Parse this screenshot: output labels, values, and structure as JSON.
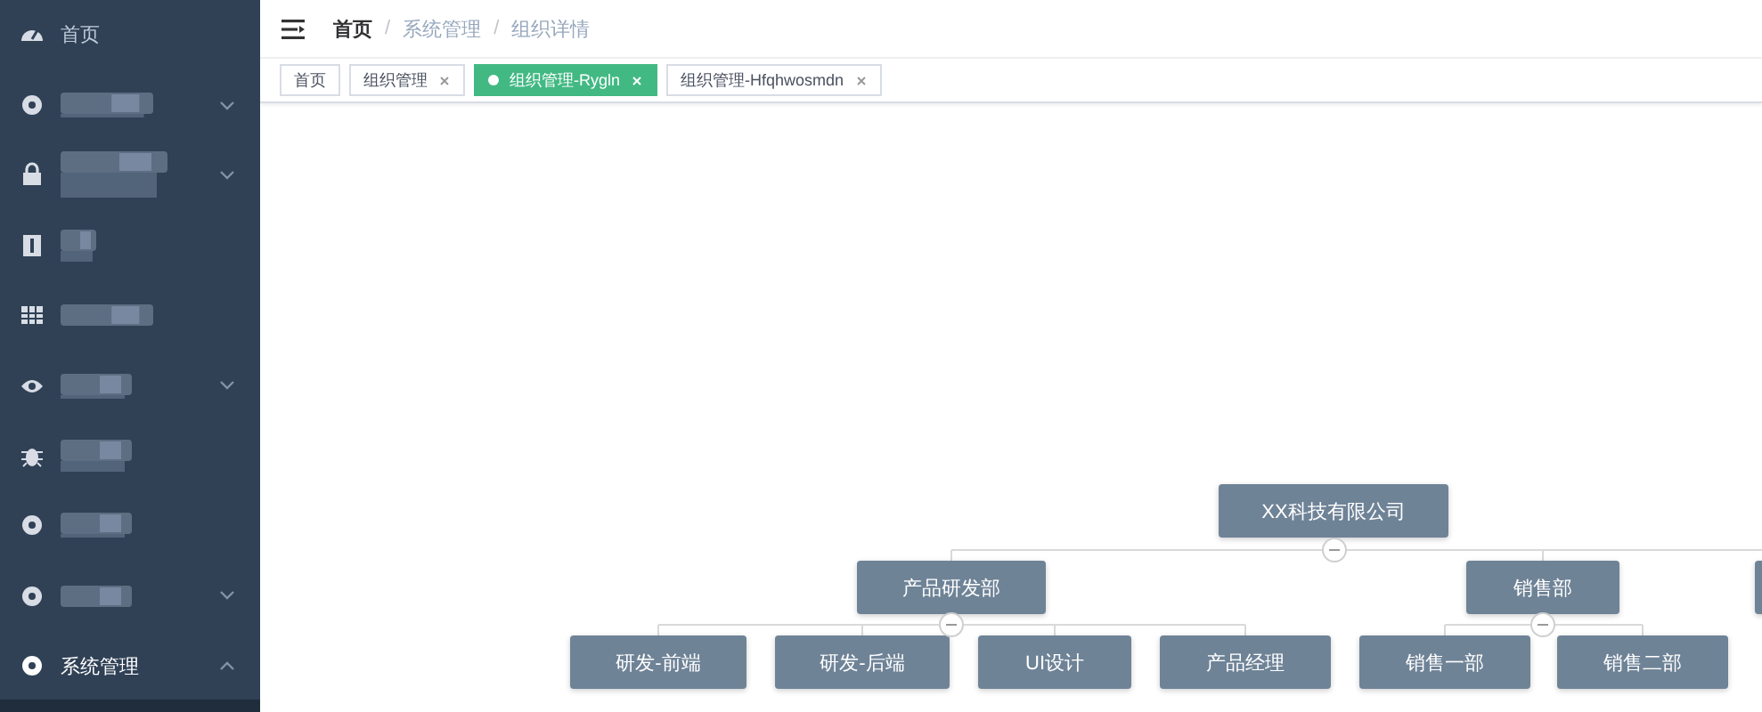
{
  "sidebar": {
    "items": [
      {
        "kind": "text",
        "label": "首页"
      },
      {
        "kind": "blurred",
        "expanded": false
      },
      {
        "kind": "blurred",
        "expanded": false
      },
      {
        "kind": "blurred"
      },
      {
        "kind": "blurred"
      },
      {
        "kind": "blurred",
        "expanded": false
      },
      {
        "kind": "blurred"
      },
      {
        "kind": "blurred"
      },
      {
        "kind": "blurred",
        "expanded": false
      },
      {
        "kind": "text",
        "label": "系统管理",
        "expanded": true
      }
    ]
  },
  "breadcrumb": [
    {
      "label": "首页"
    },
    {
      "separator": "/",
      "label": "系统管理"
    },
    {
      "separator": "/",
      "label": "组织详情"
    }
  ],
  "tags": [
    {
      "label": "首页",
      "closable": false,
      "selected": false
    },
    {
      "label": "组织管理",
      "closable": true,
      "selected": false
    },
    {
      "label": "组织管理-Rygln",
      "closable": true,
      "selected": true
    },
    {
      "label": "组织管理-Hfqhwosmdn",
      "closable": true,
      "selected": false
    }
  ],
  "org_chart": {
    "root": {
      "label": "XX科技有限公司",
      "expanded": true,
      "children": [
        {
          "kind": "box",
          "label": "产品研发部",
          "expanded": true,
          "children": [
            {
              "label": "研发-前端"
            },
            {
              "label": "研发-后端"
            },
            {
              "label": "UI设计"
            },
            {
              "label": "产品经理"
            }
          ]
        },
        {
          "kind": "box",
          "label": "销售部",
          "expanded": true,
          "children": [
            {
              "label": "销售一部"
            },
            {
              "label": "销售二部"
            }
          ]
        },
        {
          "kind": "clipped"
        }
      ]
    }
  }
}
